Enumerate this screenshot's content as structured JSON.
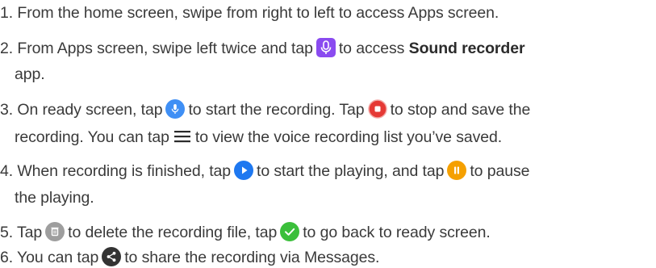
{
  "steps": [
    {
      "line1_a": "1. From the home screen, swipe from right to left to access Apps screen."
    },
    {
      "line1_a": "2. From Apps screen, swipe left twice and tap",
      "line1_b": "to access",
      "line1_bold": "Sound recorder",
      "line2": "app."
    },
    {
      "line1_a": "3. On ready screen, tap",
      "line1_b": "to start the recording. Tap",
      "line1_c": "to stop and save the",
      "line2_a": "recording. You can tap",
      "line2_b": "to view the voice recording list you’ve saved."
    },
    {
      "line1_a": "4. When recording is finished, tap",
      "line1_b": "to start the playing, and tap",
      "line1_c": "to pause",
      "line2": "the playing."
    },
    {
      "line1_a": "5. Tap",
      "line1_b": "to delete the recording file, tap",
      "line1_c": "to go back to ready screen."
    },
    {
      "line1_a": "6. You can tap",
      "line1_b": "to share the recording via Messages."
    }
  ],
  "icons": {
    "sound_recorder_app": {
      "name": "microphone-app-icon",
      "color": "#8a4bf0"
    },
    "record": {
      "name": "microphone-record-icon",
      "color": "#3f8ff5"
    },
    "stop": {
      "name": "stop-record-icon",
      "color": "#e53935"
    },
    "list": {
      "name": "list-menu-icon",
      "color": "#2b2b2b"
    },
    "play": {
      "name": "play-icon",
      "color": "#1e78f0"
    },
    "pause": {
      "name": "pause-icon",
      "color": "#f5a000"
    },
    "delete": {
      "name": "delete-icon",
      "color": "#9e9e9e"
    },
    "confirm": {
      "name": "checkmark-icon",
      "color": "#3bbf3b"
    },
    "share": {
      "name": "share-icon",
      "color": "#333333"
    }
  }
}
